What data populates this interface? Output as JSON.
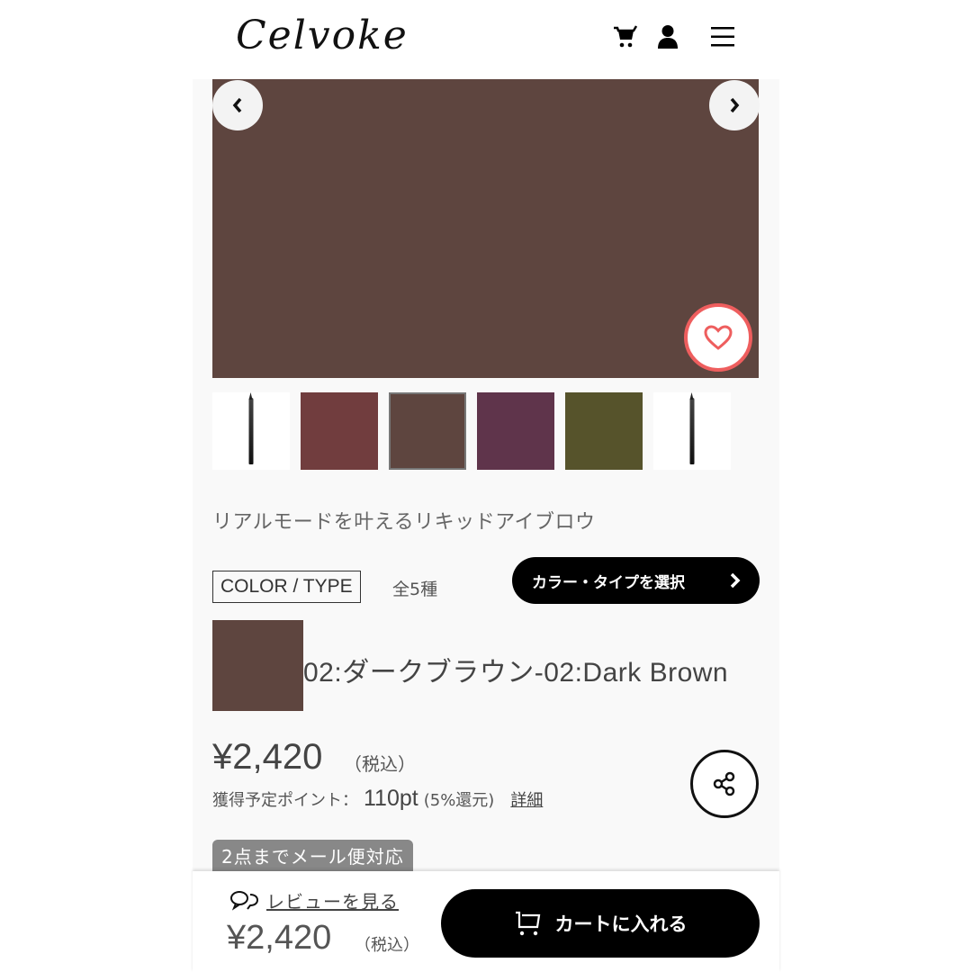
{
  "header": {
    "logo": "Celvoke",
    "icons": [
      "cart-icon",
      "user-icon",
      "menu-icon"
    ]
  },
  "gallery": {
    "main_color": "#5e453f",
    "thumbnails": [
      {
        "type": "image",
        "icon": "eyebrow-pen",
        "color": "#ffffff"
      },
      {
        "type": "color",
        "color": "#713d3e"
      },
      {
        "type": "color",
        "color": "#5e453f",
        "selected": true
      },
      {
        "type": "color",
        "color": "#5f344b"
      },
      {
        "type": "color",
        "color": "#56532b"
      },
      {
        "type": "image",
        "icon": "eyebrow-pen",
        "color": "#ffffff"
      }
    ],
    "favorite_color": "#ee5e5e"
  },
  "product": {
    "tagline": "リアルモードを叶えるリキッドアイブロウ",
    "color_label": "COLOR / TYPE",
    "color_count": "全5種",
    "select_button": "カラー・タイプを選択",
    "selected_color_name": "02:ダークブラウン-02:Dark Brown",
    "selected_color_hex": "#5e453f",
    "price": "¥2,420",
    "tax_note": "（税込）",
    "points_label": "獲得予定ポイント：",
    "points_value": "110pt",
    "points_rate": "(5%還元)",
    "points_detail_link": "詳細",
    "mail_badge": "2点までメール便対応"
  },
  "bottom_bar": {
    "review_link": "レビューを見る",
    "price": "¥2,420",
    "tax_note": "（税込）",
    "cart_button": "カートに入れる"
  }
}
